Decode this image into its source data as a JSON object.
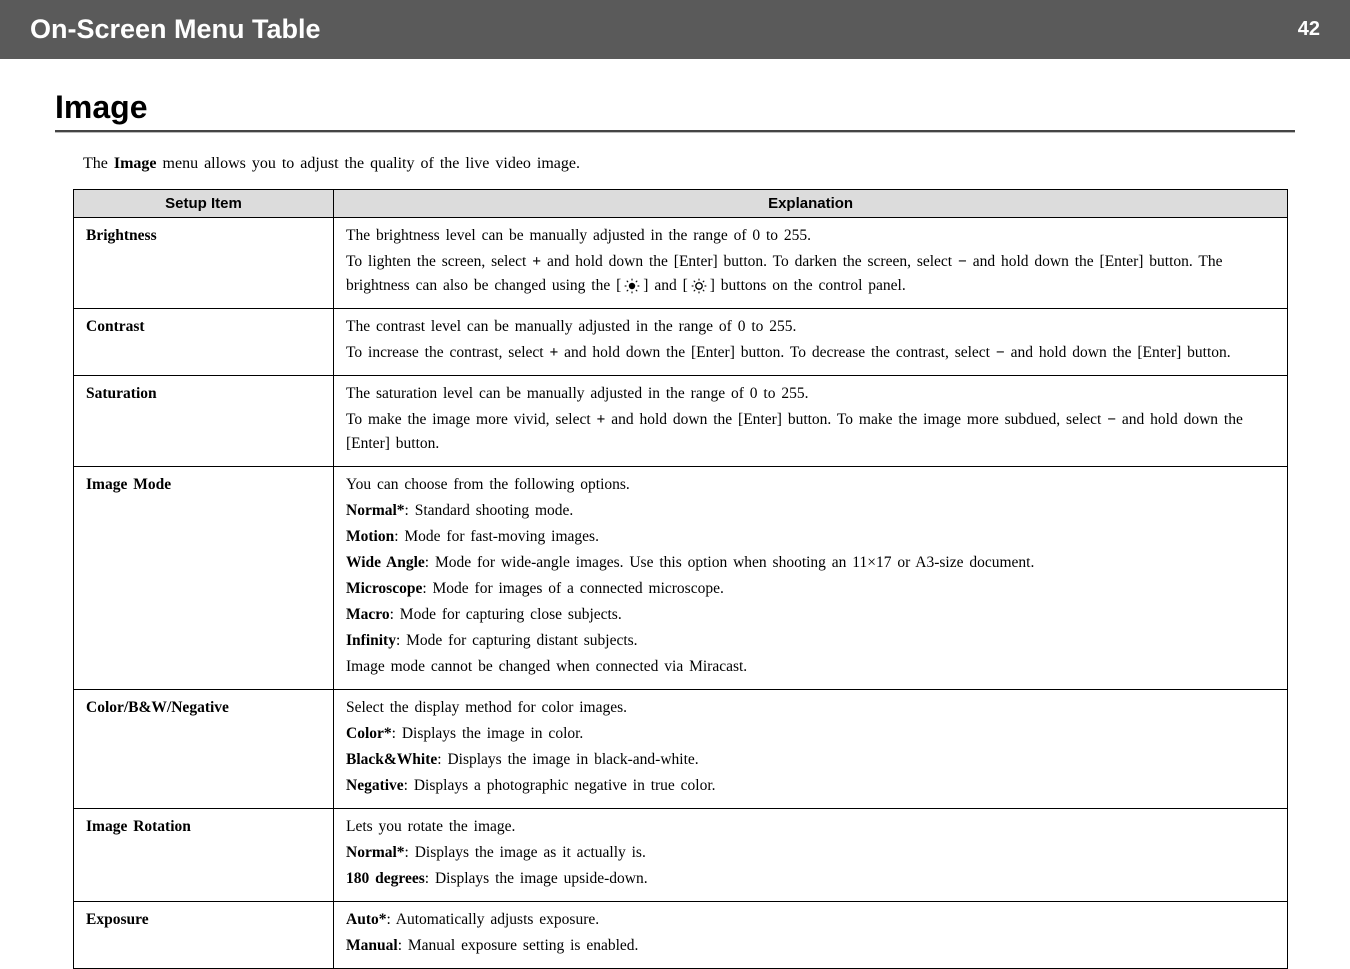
{
  "header": {
    "title": "On-Screen Menu Table",
    "pageNumber": "42"
  },
  "section": {
    "title": "Image",
    "introPrefix": "The ",
    "introBold": "Image",
    "introSuffix": " menu allows you to adjust the quality of the live video image."
  },
  "tableHeaders": {
    "col1": "Setup Item",
    "col2": "Explanation"
  },
  "rows": {
    "brightness": {
      "label": "Brightness",
      "line1": "The brightness level can be manually adjusted in the range of 0 to 255.",
      "line2a": "To lighten the screen, select ",
      "line2b": " and hold down the [Enter] button. To darken the screen, select ",
      "line2c": " and hold down the [Enter] button. The brightness can also be changed using the [",
      "line2d": "] and [",
      "line2e": "] buttons on the control panel.",
      "plus": "+",
      "minus": "−"
    },
    "contrast": {
      "label": "Contrast",
      "line1": "The contrast level can be manually adjusted in the range of 0 to 255.",
      "line2a": "To increase the contrast, select ",
      "line2b": " and hold down the [Enter] button. To decrease the contrast, select ",
      "line2c": " and hold down the [Enter] button.",
      "plus": "+",
      "minus": "−"
    },
    "saturation": {
      "label": "Saturation",
      "line1": "The saturation level can be manually adjusted in the range of 0 to 255.",
      "line2a": "To make the image more vivid, select ",
      "line2b": " and hold down the [Enter] button. To make the image more subdued, select ",
      "line2c": " and hold down the [Enter] button.",
      "plus": "+",
      "minus": "−"
    },
    "imageMode": {
      "label": "Image Mode",
      "intro": "You can choose from the following options.",
      "normalLabel": "Normal*",
      "normalText": ": Standard shooting mode.",
      "motionLabel": "Motion",
      "motionText": ": Mode for fast-moving images.",
      "wideLabel": "Wide Angle",
      "wideText": ": Mode for wide-angle images. Use this option when shooting an 11×17 or A3-size document.",
      "microLabel": "Microscope",
      "microText": ": Mode for images of a connected microscope.",
      "macroLabel": "Macro",
      "macroText": ": Mode for capturing close subjects.",
      "infinityLabel": "Infinity",
      "infinityText": ": Mode for capturing distant subjects.",
      "note": "Image mode cannot be changed when connected via Miracast."
    },
    "colorBW": {
      "label": "Color/B&W/Negative",
      "intro": "Select the display method for color images.",
      "colorLabel": "Color*",
      "colorText": ": Displays the image in color.",
      "bwLabel": "Black&White",
      "bwText": ": Displays the image in black-and-white.",
      "negLabel": "Negative",
      "negText": ": Displays a photographic negative in true color."
    },
    "rotation": {
      "label": "Image Rotation",
      "intro": "Lets you rotate the image.",
      "normalLabel": "Normal*",
      "normalText": ": Displays the image as it actually is.",
      "deg180Label": "180 degrees",
      "deg180Text": ": Displays the image upside-down."
    },
    "exposure": {
      "label": "Exposure",
      "autoLabel": "Auto*",
      "autoText": ": Automatically adjusts exposure.",
      "manualLabel": "Manual",
      "manualText": ": Manual exposure setting is enabled."
    }
  }
}
